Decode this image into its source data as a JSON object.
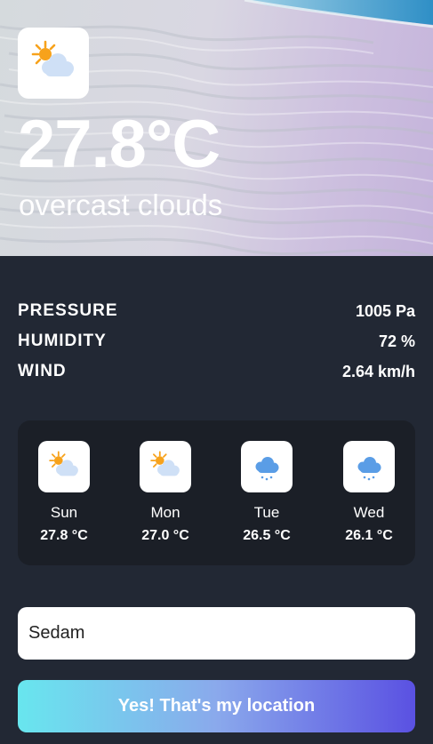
{
  "current": {
    "icon": "sun-behind-cloud-icon",
    "temperature": "27.8°C",
    "description": "overcast clouds"
  },
  "stats": [
    {
      "label": "PRESSURE",
      "value": "1005 Pa"
    },
    {
      "label": "HUMIDITY",
      "value": "72 %"
    },
    {
      "label": "WIND",
      "value": "2.64 km/h"
    }
  ],
  "forecast": [
    {
      "day": "Sun",
      "temp": "27.8 °C",
      "icon": "sun-behind-cloud-icon"
    },
    {
      "day": "Mon",
      "temp": "27.0 °C",
      "icon": "sun-behind-cloud-icon"
    },
    {
      "day": "Tue",
      "temp": "26.5 °C",
      "icon": "snow-cloud-icon"
    },
    {
      "day": "Wed",
      "temp": "26.1 °C",
      "icon": "snow-cloud-icon"
    }
  ],
  "location": {
    "value": "Sedam",
    "button_label": "Yes! That's my location"
  },
  "colors": {
    "background": "#222834",
    "forecast_panel": "#1b1f27",
    "button_gradient_start": "#68e6ee",
    "button_gradient_end": "#5a51e2",
    "sun": "#f7a21b",
    "cloud": "#cfe0f6",
    "rain_cloud": "#5a9de6"
  }
}
